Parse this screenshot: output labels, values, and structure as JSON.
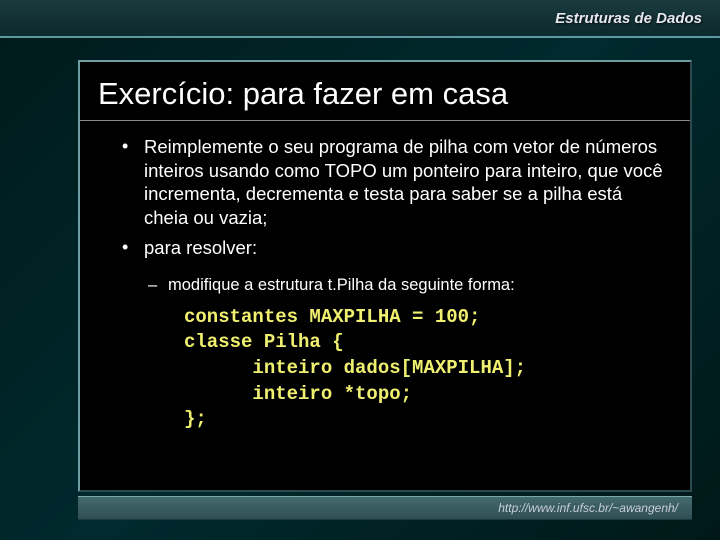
{
  "header": {
    "course_title": "Estruturas de Dados"
  },
  "slide": {
    "title": "Exercício: para fazer em casa",
    "bullets_l1": [
      "Reimplemente o seu programa de pilha com vetor de números inteiros usando como TOPO um ponteiro para inteiro, que você incrementa, decrementa e testa para saber se a pilha está cheia ou vazia;",
      "para resolver:"
    ],
    "bullet_l2": "modifique a estrutura t.Pilha da seguinte forma:",
    "code": "constantes MAXPILHA = 100;\nclasse Pilha {\n      inteiro dados[MAXPILHA];\n      inteiro *topo;\n};"
  },
  "footer": {
    "url": "http://www.inf.ufsc.br/~awangenh/"
  }
}
